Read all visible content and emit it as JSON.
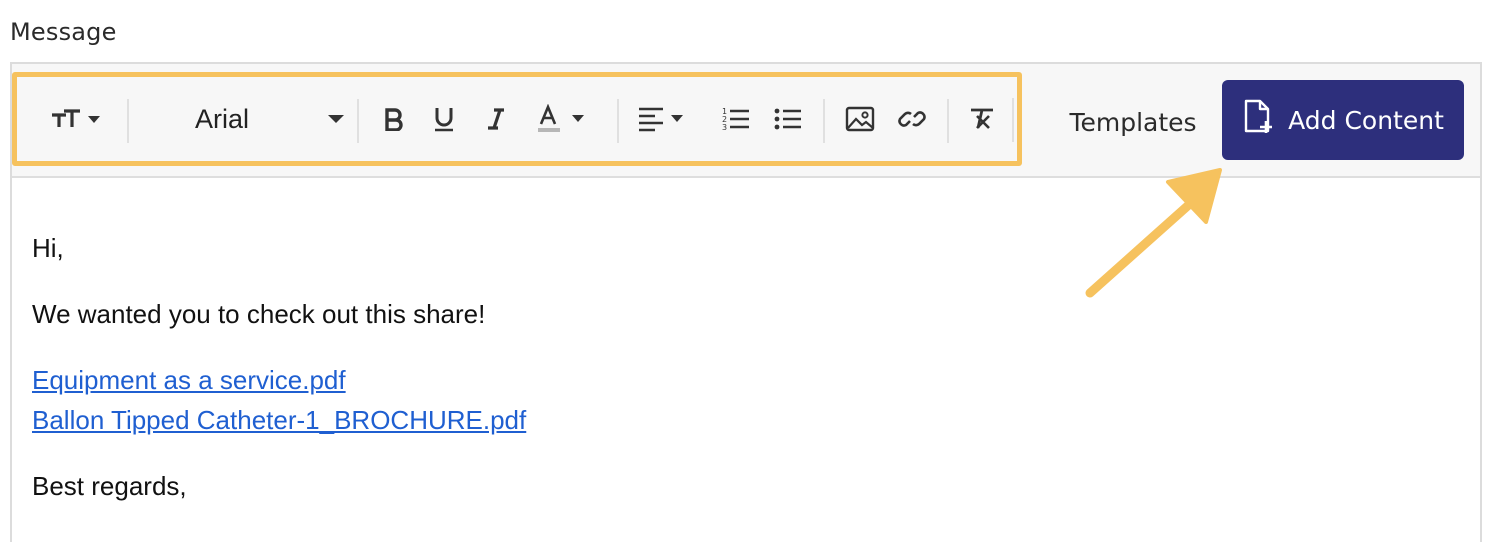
{
  "field_label": "Message",
  "toolbar": {
    "text_size_icon": "text-size-icon",
    "font_name": "Arial",
    "bold_icon": "bold-icon",
    "underline_icon": "underline-icon",
    "italic_icon": "italic-icon",
    "text_color_icon": "text-color-icon",
    "align_icon": "align-left-icon",
    "ordered_list_icon": "ordered-list-icon",
    "unordered_list_icon": "unordered-list-icon",
    "image_icon": "image-icon",
    "link_icon": "link-icon",
    "clear_format_icon": "clear-formatting-icon",
    "highlight_color": "#f6c25e"
  },
  "templates_label": "Templates",
  "add_content": {
    "label": "Add Content",
    "icon": "file-add-icon",
    "bg_color": "#2d2f7c"
  },
  "body": {
    "greeting": "Hi,",
    "message": "We wanted you to check out this share!",
    "links": [
      "Equipment as a service.pdf",
      "Ballon Tipped Catheter-1_BROCHURE.pdf"
    ],
    "signoff": "Best regards,"
  },
  "annotation_arrow_color": "#f6c25e"
}
